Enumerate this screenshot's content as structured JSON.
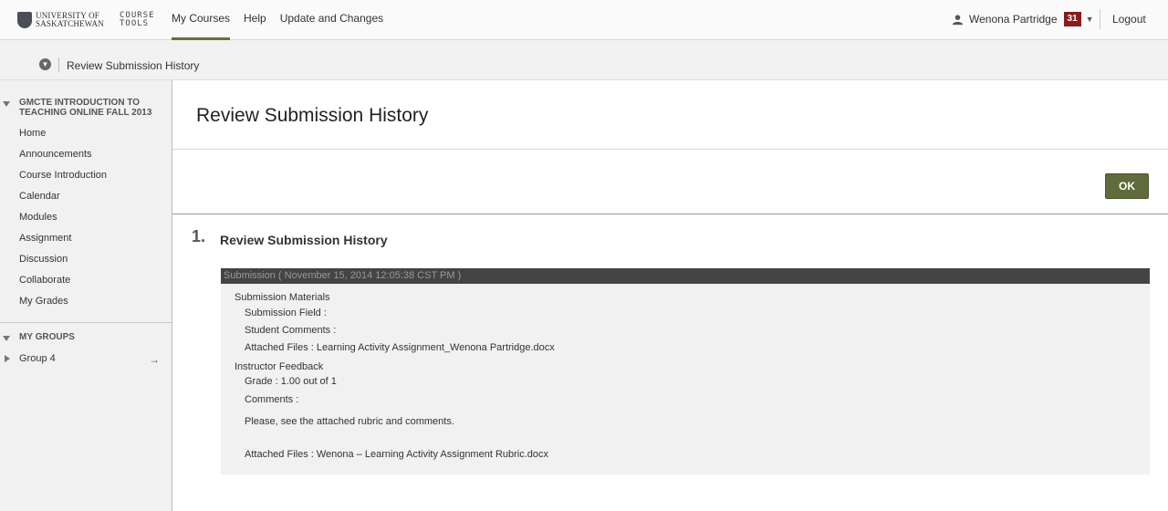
{
  "header": {
    "logo_university": "UNIVERSITY OF SASKATCHEWAN",
    "logo_product": "COURSE TOOLS",
    "nav": [
      "My Courses",
      "Help",
      "Update and Changes"
    ],
    "user_name": "Wenona Partridge",
    "notification_count": "31",
    "logout": "Logout"
  },
  "breadcrumb": {
    "current": "Review Submission History"
  },
  "sidebar": {
    "course_title": "GMCTE INTRODUCTION TO TEACHING ONLINE FALL 2013",
    "items": [
      "Home",
      "Announcements",
      "Course Introduction",
      "Calendar",
      "Modules",
      "Assignment",
      "Discussion",
      "Collaborate",
      "My Grades"
    ],
    "groups_title": "MY GROUPS",
    "group_item": "Group 4"
  },
  "main": {
    "title": "Review Submission History",
    "ok_label": "OK",
    "step_number": "1.",
    "step_title": "Review Submission History",
    "submission": {
      "header": "Submission ( November 15, 2014 12:05:38 CST PM )",
      "materials_label": "Submission Materials",
      "field_label": "Submission Field :",
      "comments_label": "Student Comments :",
      "attached_files": "Attached Files : Learning Activity Assignment_Wenona Partridge.docx",
      "feedback_label": "Instructor Feedback",
      "grade": "Grade : 1.00 out of 1",
      "feedback_comments_label": "Comments :",
      "feedback_comment": "Please, see the attached rubric and comments.",
      "feedback_attached": "Attached Files : Wenona – Learning Activity Assignment Rubric.docx"
    }
  },
  "colors": {
    "accent": "#5f6b3a",
    "badge": "#8b1a1a",
    "submission_header": "#444444"
  }
}
